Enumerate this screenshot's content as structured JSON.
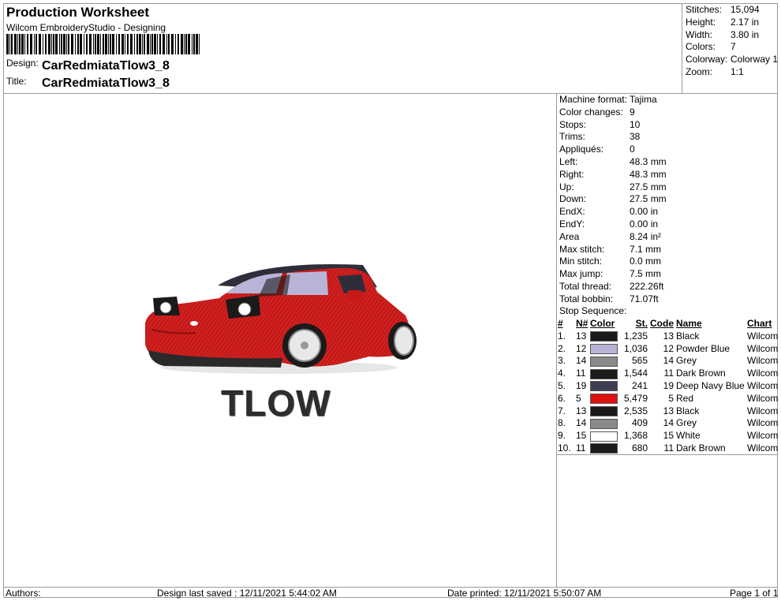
{
  "header": {
    "title": "Production Worksheet",
    "subtitle": "Wilcom EmbroideryStudio - Designing",
    "design_label": "Design:",
    "design_value": "CarRedmiataTlow3_8",
    "title_label": "Title:",
    "title_value": "CarRedmiataTlow3_8"
  },
  "summary": [
    {
      "k": "Stitches:",
      "v": "15,094"
    },
    {
      "k": "Height:",
      "v": "2.17 in"
    },
    {
      "k": "Width:",
      "v": "3.80 in"
    },
    {
      "k": "Colors:",
      "v": "7"
    },
    {
      "k": "Colorway:",
      "v": "Colorway 1"
    },
    {
      "k": "Zoom:",
      "v": "1:1"
    }
  ],
  "properties": [
    {
      "k": "Machine format:",
      "v": "Tajima"
    },
    {
      "k": "Color changes:",
      "v": "9"
    },
    {
      "k": "Stops:",
      "v": "10"
    },
    {
      "k": "Trims:",
      "v": "38"
    },
    {
      "k": "Appliqués:",
      "v": "0"
    },
    {
      "k": "Left:",
      "v": "48.3 mm"
    },
    {
      "k": "Right:",
      "v": "48.3 mm"
    },
    {
      "k": "Up:",
      "v": "27.5 mm"
    },
    {
      "k": "Down:",
      "v": "27.5 mm"
    },
    {
      "k": "EndX:",
      "v": "0.00 in"
    },
    {
      "k": "EndY:",
      "v": "0.00 in"
    },
    {
      "k": "Area",
      "v": "8.24 in²"
    },
    {
      "k": "Max stitch:",
      "v": "7.1 mm"
    },
    {
      "k": "Min stitch:",
      "v": "0.0 mm"
    },
    {
      "k": "Max jump:",
      "v": "7.5 mm"
    },
    {
      "k": "Total thread:",
      "v": "222.26ft"
    },
    {
      "k": "Total bobbin:",
      "v": "71.07ft"
    }
  ],
  "stop_sequence_title": "Stop Sequence:",
  "stop_headers": {
    "num": "#",
    "n": "N#",
    "color": "Color",
    "st": "St.",
    "code": "Code",
    "name": "Name",
    "chart": "Chart"
  },
  "stops": [
    {
      "num": "1.",
      "n": "13",
      "hex": "#1a1a1a",
      "st": "1,235",
      "code": "13",
      "name": "Black",
      "chart": "Wilcom"
    },
    {
      "num": "2.",
      "n": "12",
      "hex": "#b8b4d8",
      "st": "1,036",
      "code": "12",
      "name": "Powder Blue",
      "chart": "Wilcom"
    },
    {
      "num": "3.",
      "n": "14",
      "hex": "#8a8a8a",
      "st": "565",
      "code": "14",
      "name": "Grey",
      "chart": "Wilcom"
    },
    {
      "num": "4.",
      "n": "11",
      "hex": "#1c1a1a",
      "st": "1,544",
      "code": "11",
      "name": "Dark Brown",
      "chart": "Wilcom"
    },
    {
      "num": "5.",
      "n": "19",
      "hex": "#3e3e52",
      "st": "241",
      "code": "19",
      "name": "Deep Navy Blue",
      "chart": "Wilcom"
    },
    {
      "num": "6.",
      "n": "5",
      "hex": "#e01010",
      "st": "5,479",
      "code": "5",
      "name": "Red",
      "chart": "Wilcom"
    },
    {
      "num": "7.",
      "n": "13",
      "hex": "#1a1a1a",
      "st": "2,535",
      "code": "13",
      "name": "Black",
      "chart": "Wilcom"
    },
    {
      "num": "8.",
      "n": "14",
      "hex": "#8a8a8a",
      "st": "409",
      "code": "14",
      "name": "Grey",
      "chart": "Wilcom"
    },
    {
      "num": "9.",
      "n": "15",
      "hex": "#ffffff",
      "st": "1,368",
      "code": "15",
      "name": "White",
      "chart": "Wilcom"
    },
    {
      "num": "10.",
      "n": "11",
      "hex": "#1c1a1a",
      "st": "680",
      "code": "11",
      "name": "Dark Brown",
      "chart": "Wilcom"
    }
  ],
  "design_text": "TLOW",
  "footer": {
    "authors": "Authors:",
    "saved": "Design last saved : 12/11/2021 5:44:02 AM",
    "printed": "Date printed: 12/11/2021 5:50:07 AM",
    "page": "Page 1 of 1"
  }
}
